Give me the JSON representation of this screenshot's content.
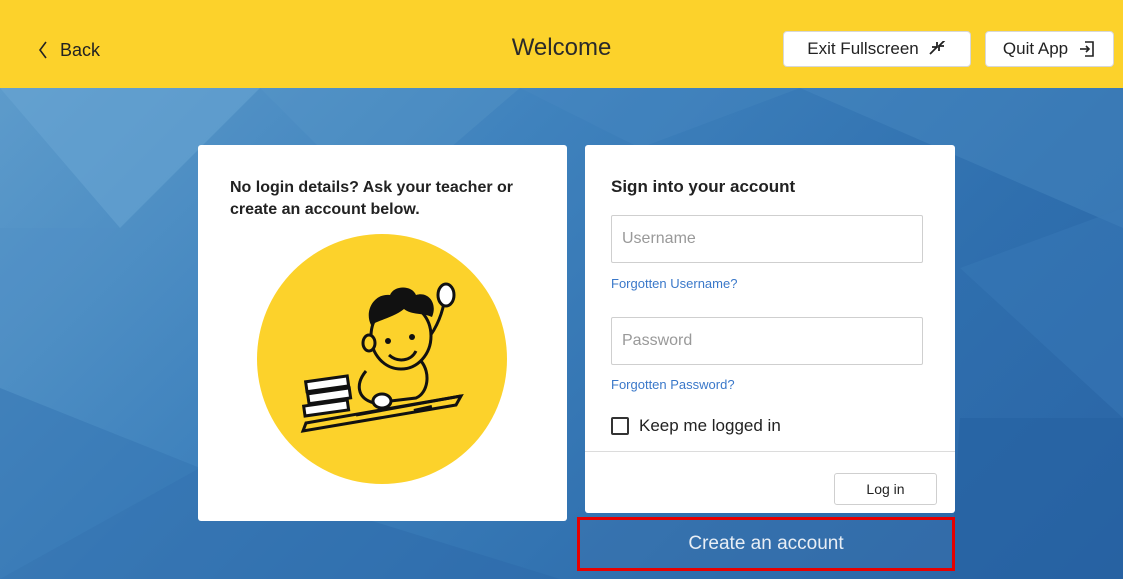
{
  "header": {
    "back_label": "Back",
    "title": "Welcome",
    "exit_fullscreen_label": "Exit Fullscreen",
    "quit_app_label": "Quit App"
  },
  "left_card": {
    "message": "No login details? Ask your teacher or create an account below."
  },
  "sign_in": {
    "title": "Sign into your account",
    "username_placeholder": "Username",
    "forgot_username": "Forgotten Username?",
    "password_placeholder": "Password",
    "forgot_password": "Forgotten Password?",
    "keep_logged_in": "Keep me logged in",
    "login_label": "Log in"
  },
  "create_account_label": "Create an account",
  "colors": {
    "header_bg": "#fcd22b",
    "background": "#3f82bd",
    "link": "#3a78c9",
    "highlight_border": "#e60000",
    "illustration_circle": "#fcd22b"
  },
  "icons": [
    "chevron-left-icon",
    "exit-fullscreen-icon",
    "quit-app-icon",
    "checkbox-icon"
  ]
}
